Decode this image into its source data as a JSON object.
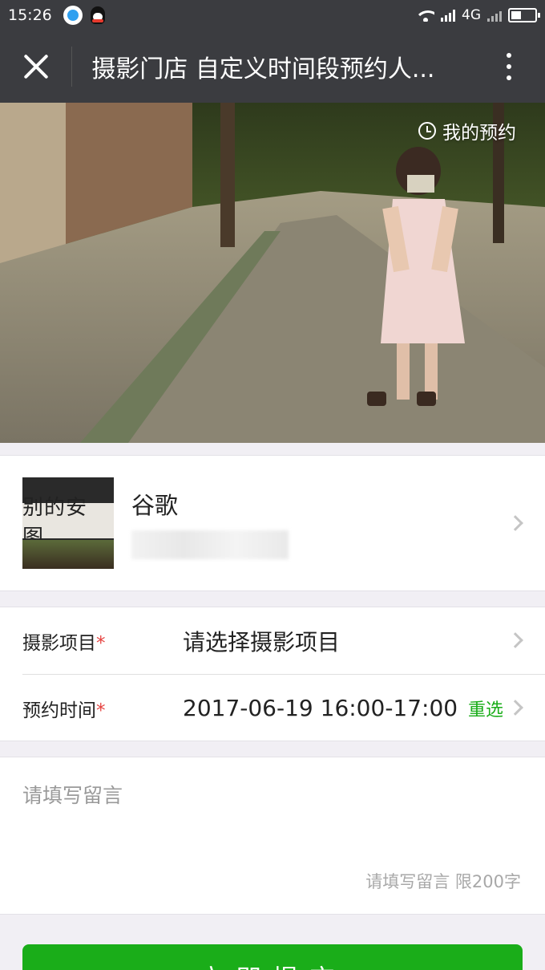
{
  "status_bar": {
    "time": "15:26",
    "network": "4G"
  },
  "title_bar": {
    "title": "摄影门店 自定义时间段预约人...",
    "close_icon": "close-icon",
    "more_icon": "more-vertical-icon"
  },
  "banner": {
    "my_booking_label": "我的预约",
    "icon": "clock-icon"
  },
  "store": {
    "name": "谷歌",
    "thumb_sign": "别的安 图"
  },
  "form": {
    "project": {
      "label": "摄影项目",
      "required_mark": "*",
      "value": "请选择摄影项目"
    },
    "time": {
      "label": "预约时间",
      "required_mark": "*",
      "value": "2017-06-19 16:00-17:00",
      "reselect_label": "重选"
    }
  },
  "message": {
    "placeholder": "请填写留言",
    "hint": "请填写留言 限200字"
  },
  "submit": {
    "label": "立即提交"
  },
  "colors": {
    "accent": "#1aad19",
    "required": "#e64340",
    "titlebar": "#3b3c40"
  }
}
